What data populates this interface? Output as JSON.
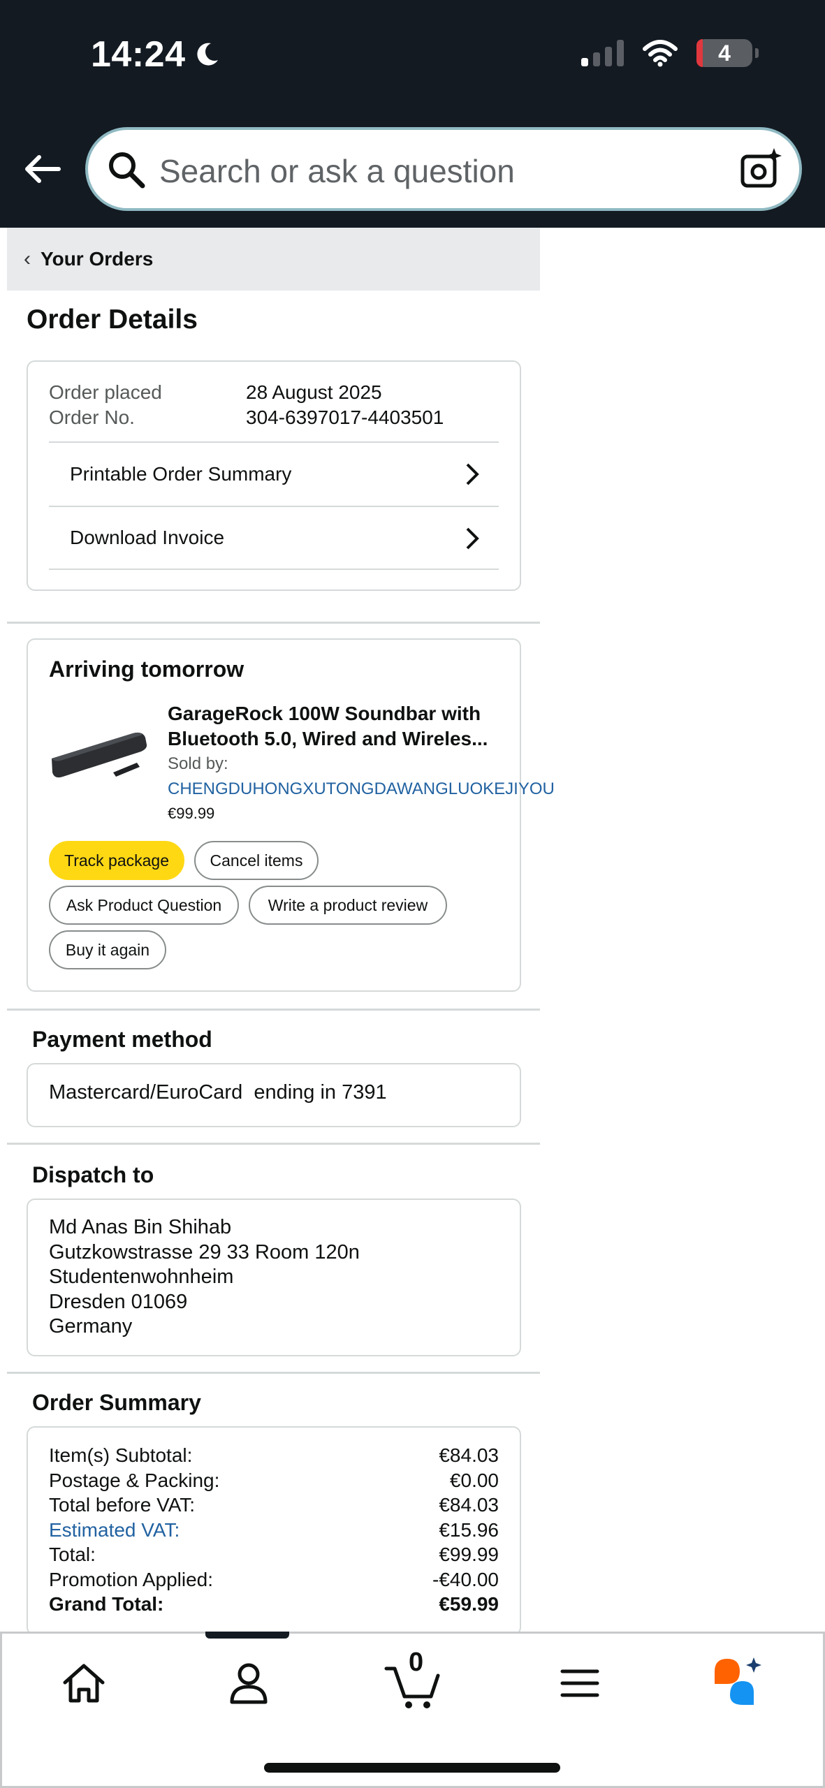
{
  "status_bar": {
    "time": "14:24",
    "battery": "4"
  },
  "search": {
    "placeholder": "Search or ask a question"
  },
  "breadcrumb": {
    "label": "Your Orders"
  },
  "page_title": "Order Details",
  "order_info": {
    "placed_label": "Order placed",
    "placed_value": "28 August 2025",
    "number_label": "Order No.",
    "number_value": "304-6397017-4403501",
    "links": [
      "Printable Order Summary",
      "Download Invoice"
    ]
  },
  "shipment": {
    "heading": "Arriving tomorrow",
    "product_title_line1": "GarageRock 100W Soundbar with",
    "product_title_line2": "Bluetooth 5.0, Wired and Wireles...",
    "sold_by_label": "Sold by:",
    "seller": "CHENGDUHONGXUTONGDAWANGLUOKEJIYOU",
    "price": "€99.99",
    "actions": [
      "Track package",
      "Cancel items",
      "Ask Product Question",
      "Write a product review",
      "Buy it again"
    ]
  },
  "payment": {
    "heading": "Payment method",
    "method": "Mastercard/EuroCard  ending in 7391"
  },
  "dispatch": {
    "heading": "Dispatch to",
    "lines": [
      "Md Anas Bin Shihab",
      "Gutzkowstrasse 29 33 Room 120n",
      "Studentenwohnheim",
      "Dresden 01069",
      "Germany"
    ]
  },
  "summary": {
    "heading": "Order Summary",
    "rows": [
      {
        "label": "Item(s) Subtotal:",
        "value": "€84.03"
      },
      {
        "label": "Postage & Packing:",
        "value": "€0.00"
      },
      {
        "label": "Total before VAT:",
        "value": "€84.03"
      },
      {
        "label": "Estimated VAT:",
        "value": "€15.96"
      },
      {
        "label": "Total:",
        "value": "€99.99"
      },
      {
        "label": "Promotion Applied:",
        "value": "-€40.00"
      },
      {
        "label": "Grand Total:",
        "value": "€59.99"
      }
    ]
  },
  "bottom_nav": {
    "cart_count": "0",
    "items": [
      "home-icon",
      "account-icon",
      "cart-icon",
      "menu-icon",
      "rufus-assistant-icon"
    ]
  },
  "colors": {
    "header_bg": "#131a22",
    "primary_button": "#ffd814",
    "link": "#2162a1"
  }
}
